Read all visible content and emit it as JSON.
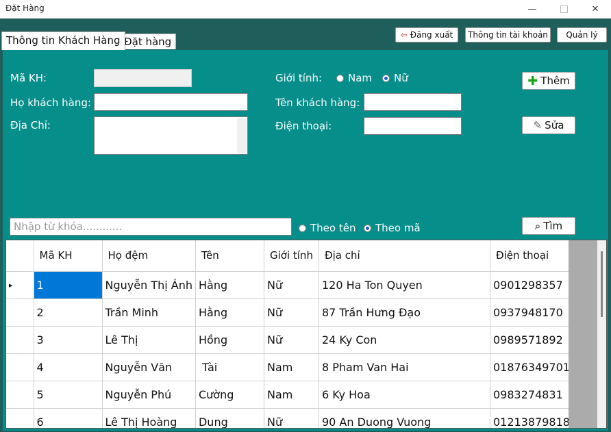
{
  "window": {
    "title": "Đặt Hàng",
    "min": "—",
    "close": "✕"
  },
  "topbar": {
    "logout": "Đăng xuất",
    "account": "Thông tin tài khoản",
    "manage": "Quản lý"
  },
  "tabs": {
    "customer": "Thông tin Khách Hàng",
    "order": "Đặt hàng"
  },
  "form": {
    "makh_label": "Mã KH:",
    "ho_label": "Họ khách hàng:",
    "diachi_label": "Địa Chỉ:",
    "gioitinh_label": "Giới tính:",
    "nam": "Nam",
    "nu": "Nữ",
    "ten_label": "Tên khách hàng:",
    "dienthoai_label": "Điện thoại:",
    "gender_selected": "Nữ"
  },
  "buttons": {
    "them": "Thêm",
    "sua": "Sửa",
    "tim": "Tìm"
  },
  "search": {
    "placeholder": "Nhập từ khóa............",
    "theo_ten": "Theo tên",
    "theo_ma": "Theo mã",
    "mode_selected": "Theo mã"
  },
  "grid": {
    "columns": [
      "Mã KH",
      "Họ đệm",
      "Tên",
      "Giới tính",
      "Địa chỉ",
      "Điện thoại"
    ],
    "rows": [
      [
        "1",
        "Nguyễn Thị Ánh",
        "Hằng",
        "Nữ",
        "120 Ha Ton Quyen",
        "0901298357"
      ],
      [
        "2",
        "Trần Minh",
        "Hằng",
        "Nữ",
        "87 Trần Hưng Đạo",
        "0937948170"
      ],
      [
        "3",
        "Lê Thị",
        "Hồng",
        "Nữ",
        "24 Ky Con",
        "0989571892"
      ],
      [
        "4",
        "Nguyễn Văn",
        " Tài",
        "Nam",
        "8 Pham Van Hai",
        "01876349701"
      ],
      [
        "5",
        "Nguyễn Phú",
        "Cường",
        "Nam",
        "6 Ky Hoa",
        "0983274831"
      ],
      [
        "6",
        "Lê Thị Hoàng",
        "Dung",
        "Nữ",
        "90 An Duong Vuong",
        "01213879818"
      ]
    ],
    "current_row_marker": "▸"
  }
}
